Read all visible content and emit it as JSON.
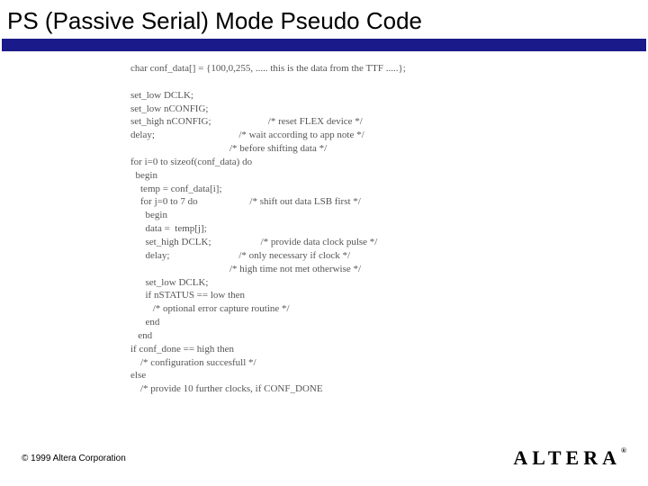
{
  "title": "PS (Passive Serial) Mode Pseudo Code",
  "code": "char conf_data[] = {100,0,255, ..... this is the data from the TTF .....};\n\nset_low DCLK;\nset_low nCONFIG;\nset_high nCONFIG;                       /* reset FLEX device */\ndelay;                                  /* wait according to app note */\n                                        /* before shifting data */\nfor i=0 to sizeof(conf_data) do\n  begin\n    temp = conf_data[i];\n    for j=0 to 7 do                     /* shift out data LSB first */\n      begin\n      data =  temp[j];\n      set_high DCLK;                    /* provide data clock pulse */\n      delay;                            /* only necessary if clock */\n                                        /* high time not met otherwise */\n      set_low DCLK;\n      if nSTATUS == low then\n         /* optional error capture routine */\n      end\n   end\nif conf_done == high then\n    /* configuration succesfull */\nelse\n    /* provide 10 further clocks, if CONF_DONE",
  "copyright": "© 1999 Altera Corporation",
  "logo_text": "ALTERA",
  "logo_reg": "®"
}
